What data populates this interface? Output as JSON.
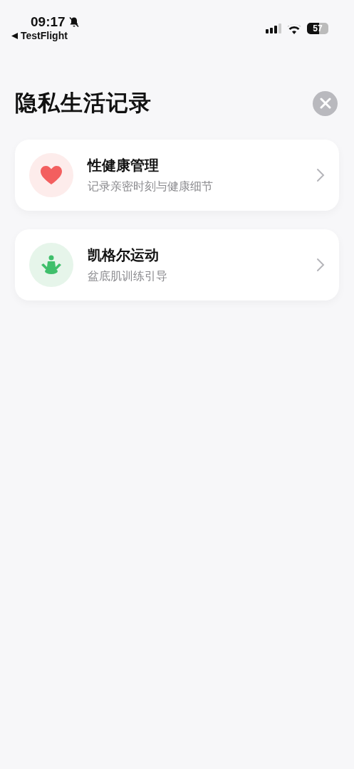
{
  "status_bar": {
    "time": "09:17",
    "back_label": "TestFlight",
    "battery": "57"
  },
  "title": "隐私生活记录",
  "items": [
    {
      "kind": "heart",
      "title": "性健康管理",
      "subtitle": "记录亲密时刻与健康细节"
    },
    {
      "kind": "meditation",
      "title": "凯格尔运动",
      "subtitle": "盆底肌训练引导"
    }
  ]
}
